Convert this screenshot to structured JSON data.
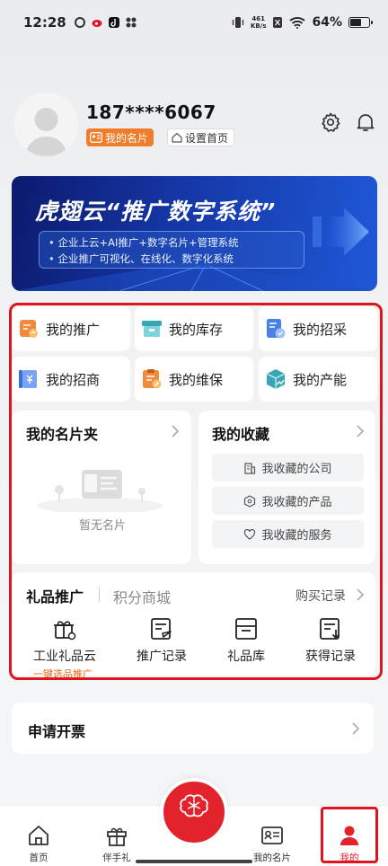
{
  "status_bar": {
    "time": "12:28",
    "net_speed": "461",
    "net_unit": "KB/s",
    "battery": "64%",
    "battery_level": 0.64
  },
  "profile": {
    "phone": "187****6067",
    "card_label": "我的名片",
    "home_label": "设置首页"
  },
  "banner": {
    "title": "虎翅云“推广数字系统”",
    "line1": "企业上云+AI推广+数字名片+管理系统",
    "line2": "企业推广可视化、在线化、数字化系统"
  },
  "grid": [
    {
      "label": "我的推广",
      "icon": "promotion-icon"
    },
    {
      "label": "我的库存",
      "icon": "inventory-icon"
    },
    {
      "label": "我的招采",
      "icon": "procurement-icon"
    },
    {
      "label": "我的招商",
      "icon": "investment-icon"
    },
    {
      "label": "我的维保",
      "icon": "maintenance-icon"
    },
    {
      "label": "我的产能",
      "icon": "capacity-icon"
    }
  ],
  "card_folder": {
    "title": "我的名片夹",
    "empty": "暂无名片"
  },
  "favorites": {
    "title": "我的收藏",
    "items": [
      "我收藏的公司",
      "我收藏的产品",
      "我收藏的服务"
    ]
  },
  "gifts": {
    "tab1": "礼品推广",
    "tab2": "积分商城",
    "buy_records": "购买记录",
    "items": [
      "工业礼品云",
      "推广记录",
      "礼品库",
      "获得记录"
    ],
    "sub": "一键选品推广"
  },
  "invoice": {
    "label": "申请开票"
  },
  "tabbar": {
    "home": "首页",
    "gift": "伴手礼",
    "center": "推广大脑",
    "card": "我的名片",
    "mine": "我的"
  },
  "colors": {
    "accent": "#e3232c",
    "orange": "#ef7d2a",
    "frame": "#e0141e"
  }
}
